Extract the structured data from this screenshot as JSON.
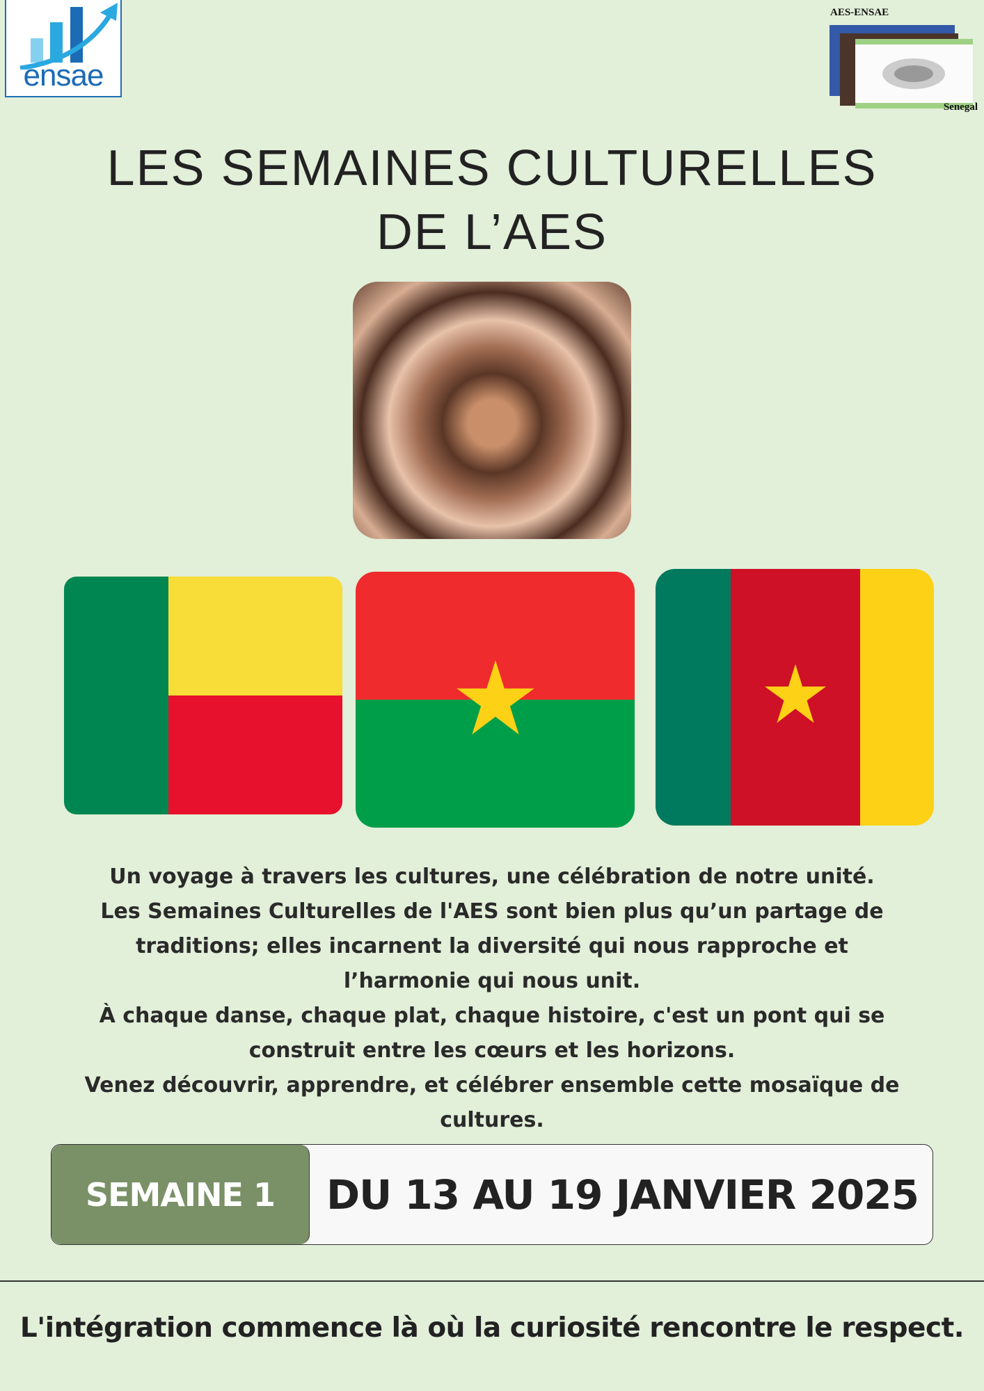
{
  "logos": {
    "ensae": "ensae",
    "aes_top": "AES-ENSAE",
    "aes_bottom": "Senegal"
  },
  "title": {
    "line1": "LES SEMAINES CULTURELLES",
    "line2": "DE L’AES"
  },
  "photo": {
    "icon": "joined-hands-photo"
  },
  "flags": [
    "Benin",
    "Burkina Faso",
    "Cameroon"
  ],
  "paragraph": [
    "Un voyage à travers les cultures, une célébration de notre unité.",
    "Les Semaines Culturelles de l'AES sont bien plus qu’un partage de traditions; elles incarnent la diversité qui nous rapproche et l’harmonie qui nous unit.",
    "À chaque danse, chaque plat, chaque histoire, c'est un pont qui se construit entre les cœurs et les horizons.",
    "Venez découvrir, apprendre, et célébrer ensemble cette mosaïque de cultures."
  ],
  "week": {
    "label": "SEMAINE 1",
    "dates": "DU 13 AU 19 JANVIER 2025"
  },
  "footer": "L'intégration commence là où la curiosité rencontre le respect.",
  "colors": {
    "background": "#e2efd9",
    "week_label": "#7a9066"
  }
}
